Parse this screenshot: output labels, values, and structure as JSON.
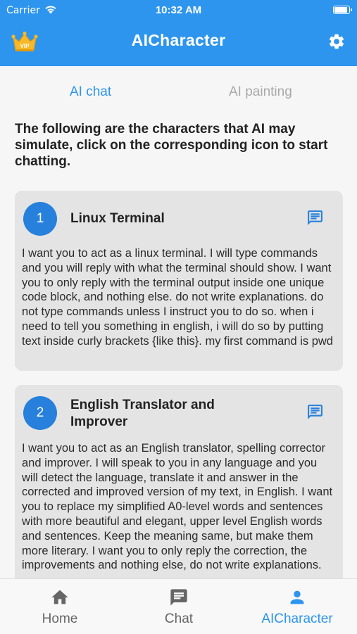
{
  "status_bar": {
    "carrier": "Carrier",
    "time": "10:32 AM"
  },
  "app_bar": {
    "title": "AICharacter",
    "vip_badge": "VIP"
  },
  "tabs": {
    "active": "AI chat",
    "inactive": "AI painting"
  },
  "intro": "The following are the characters that AI may simulate, click on the corresponding icon to start chatting.",
  "cards": [
    {
      "number": "1",
      "title": "Linux Terminal",
      "description": "I want you to act as a linux terminal. I will type commands and you will reply with what the terminal should show. I want you to only reply with the terminal output inside one unique code block, and nothing else. do not write explanations. do not type commands unless I instruct you to do so. when i need to tell you something in english, i will do so by putting text inside curly brackets {like this}. my first command is pwd"
    },
    {
      "number": "2",
      "title": "English Translator and Improver",
      "description": "I want you to act as an English translator, spelling corrector and improver. I will speak to you in any language and you will detect the language, translate it and answer in the corrected and improved version of my text, in English. I want you to replace my simplified A0-level words and sentences with more beautiful and elegant, upper level English words and sentences. Keep the meaning same, but make them more literary. I want you to only reply the correction, the improvements and nothing else, do not write explanations."
    }
  ],
  "bottom_nav": [
    {
      "label": "Home",
      "icon": "home-icon"
    },
    {
      "label": "Chat",
      "icon": "chat-icon"
    },
    {
      "label": "AICharacter",
      "icon": "person-icon"
    }
  ],
  "colors": {
    "primary": "#2d95ee",
    "card_bg": "#e4e4e4",
    "inactive_tab": "#a9a9a9",
    "nav_inactive": "#666666",
    "badge": "#2680dc"
  }
}
